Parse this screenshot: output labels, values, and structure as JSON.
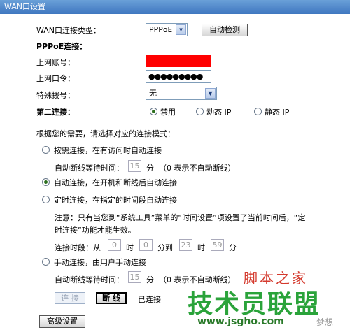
{
  "window": {
    "title": "WAN口设置"
  },
  "wan": {
    "type_label": "WAN口连接类型：",
    "type_value": "PPPoE",
    "detect_button": "自动检测",
    "pppoe_heading": "PPPoE连接：",
    "account_label": "上网账号：",
    "password_label": "上网口令：",
    "password_value": "●●●●●●●●●",
    "special_dial_label": "特殊拨号：",
    "special_dial_value": "无",
    "second_conn_label": "第二连接：",
    "second_options": [
      "禁用",
      "动态 IP",
      "静态 IP"
    ],
    "prompt": "根据您的需要，请选择对应的连接模式："
  },
  "modes": {
    "on_demand": "按需连接，在有访问时自动连接",
    "idle_label": "自动断线等待时间：",
    "idle_value": "15",
    "idle_unit": "分",
    "idle_hint": "（0 表示不自动断线）",
    "auto": "自动连接，在开机和断线后自动连接",
    "timed": "定时连接，在指定的时间段自动连接",
    "timed_note_1": "注意：只有当您到“系统工具”菜单的“时间设置”项设置了当前时间后，“定",
    "timed_note_2": "时连接”功能才能生效。",
    "period_label": "连接时段：从",
    "from_h": "0",
    "hour_unit": "时",
    "from_m": "0",
    "to_label": "分到",
    "to_h": "23",
    "to_m": "59",
    "min_unit": "分",
    "manual": "手动连接，由用户手动连接",
    "manual_idle_value": "15",
    "manual_idle_hint": "（0 表示不自动断线）"
  },
  "actions": {
    "connect": "连 接",
    "disconnect": "断 线",
    "status": "已连接",
    "advanced": "高级设置"
  },
  "watermark": {
    "line1": "脚本之家",
    "line2": "技术员联盟",
    "url": "www.jsgho.com",
    "tag": "梦想"
  },
  "colors": {
    "title_bar": "#3f77c0",
    "radio_checked": "#2c6f1e",
    "redaction": "#ff0000"
  }
}
